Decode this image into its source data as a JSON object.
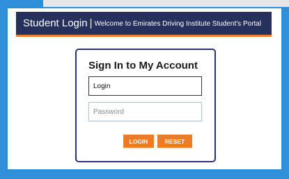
{
  "header": {
    "title": "Student Login",
    "separator": "|",
    "subtitle": "Welcome to Emirates Driving Institute Student's Portal"
  },
  "login_card": {
    "heading": "Sign In to My Account",
    "login_field": {
      "value": "Login",
      "placeholder": ""
    },
    "password_field": {
      "value": "",
      "placeholder": "Password"
    },
    "login_button": "LOGIN",
    "reset_button": "RESET"
  },
  "colors": {
    "background": "#2f8fd6",
    "header_bg": "#25305c",
    "accent": "#f07b22",
    "card_border": "#26307a"
  }
}
